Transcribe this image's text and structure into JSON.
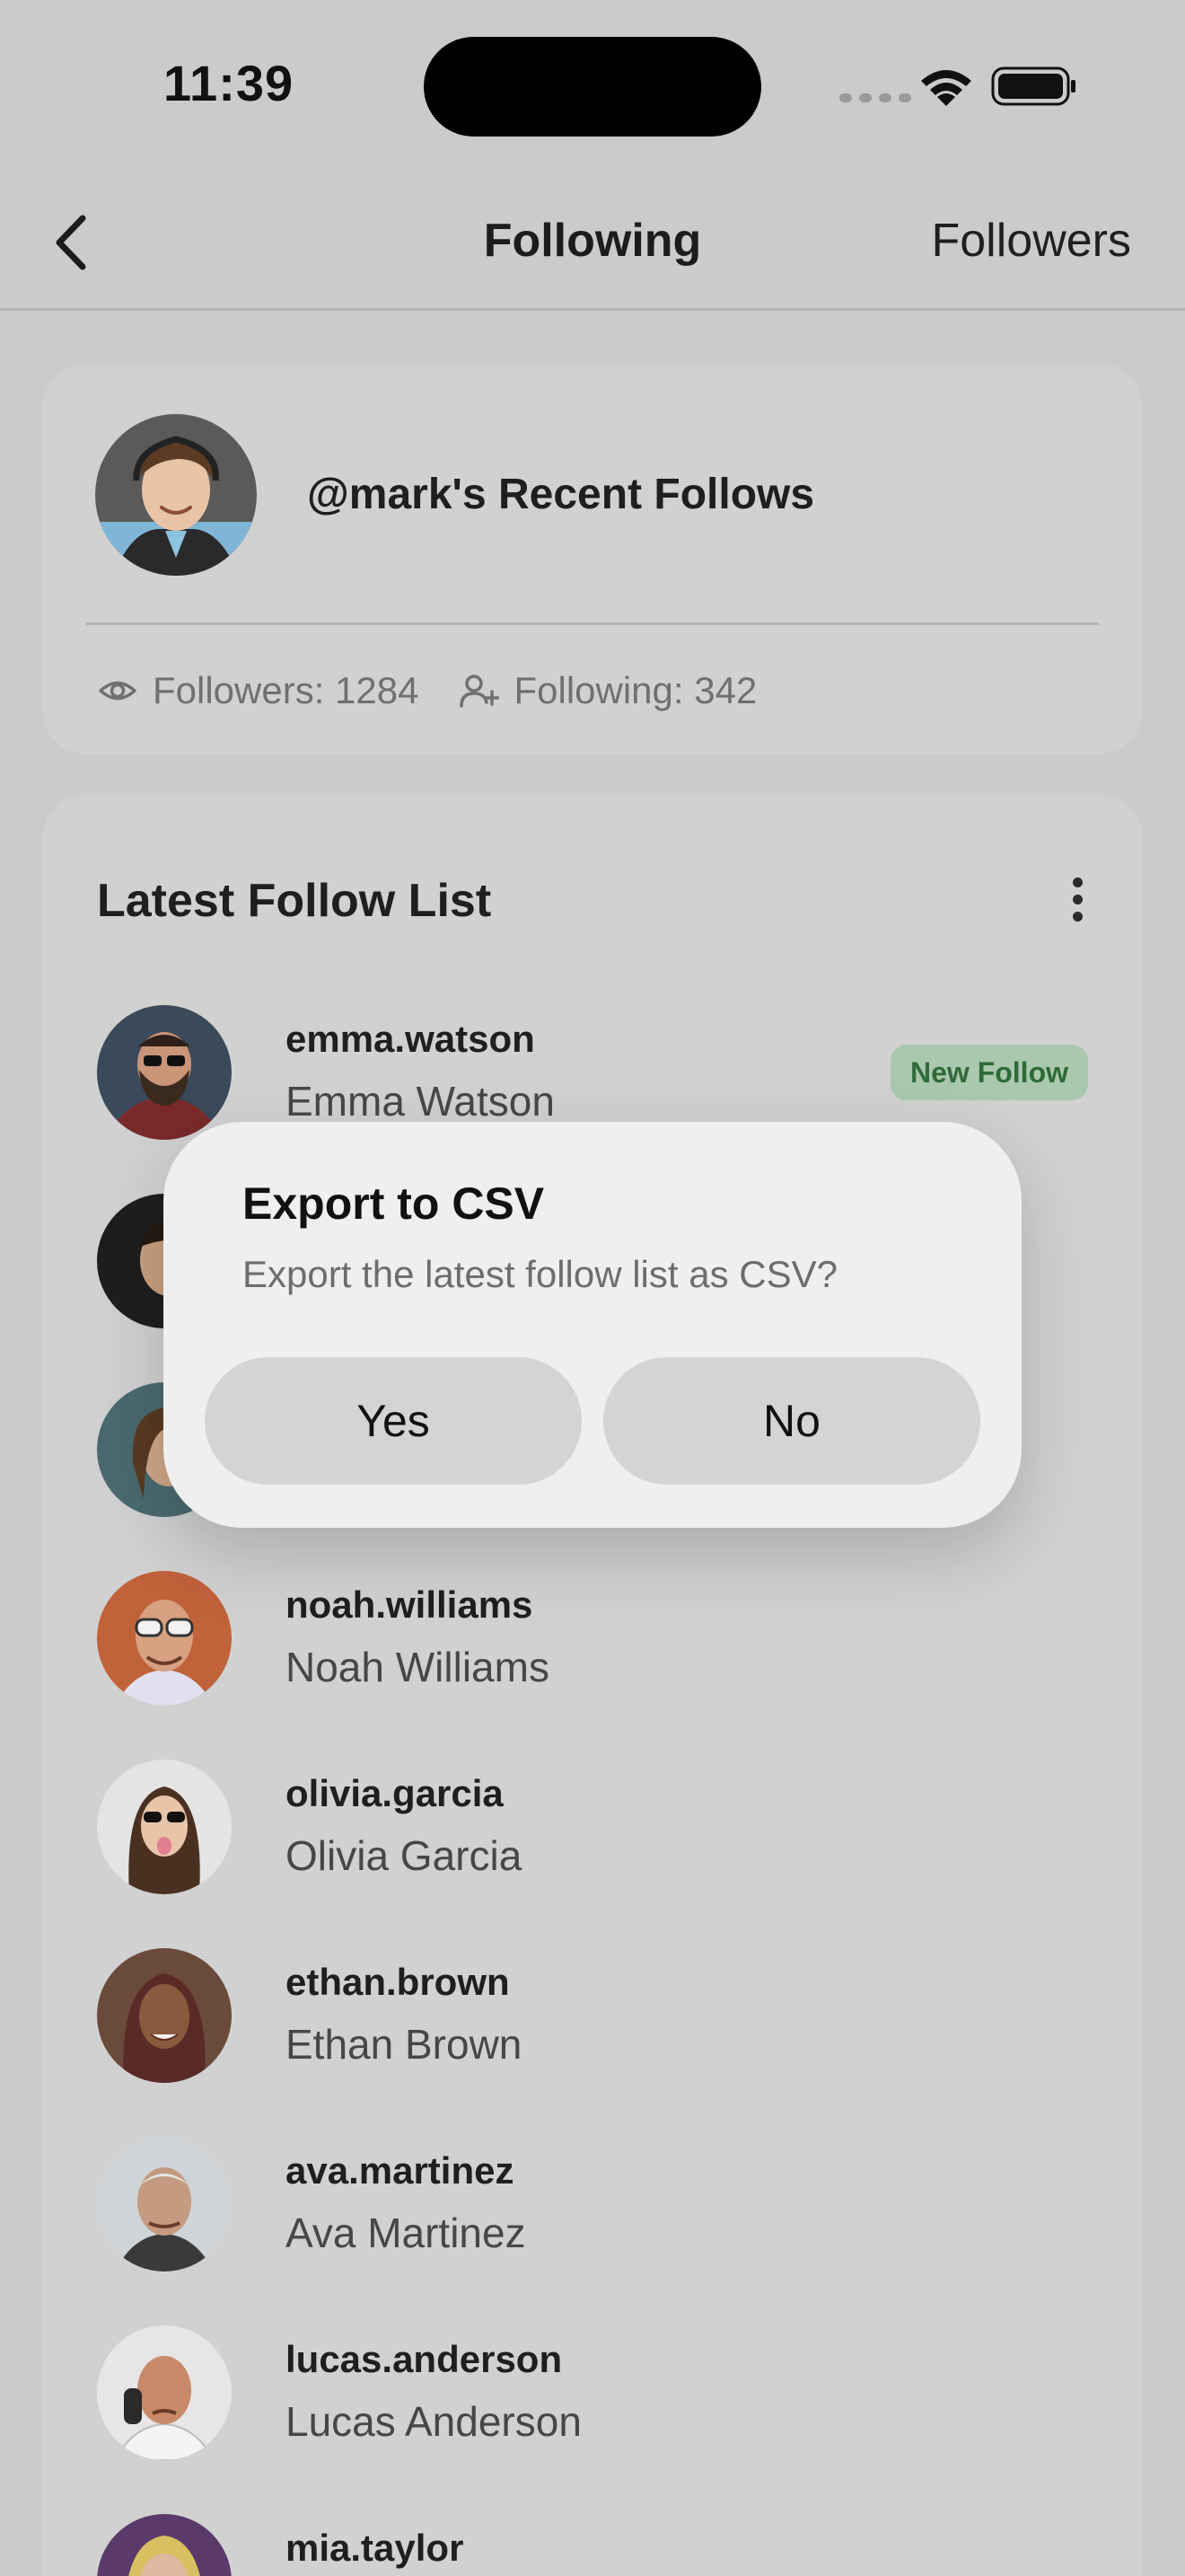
{
  "status_bar": {
    "time": "11:39"
  },
  "nav": {
    "title": "Following",
    "right_link": "Followers"
  },
  "profile": {
    "title": "@mark's Recent Follows",
    "followers": "Followers: 1284",
    "following": "Following: 342"
  },
  "list": {
    "title": "Latest Follow List",
    "items": [
      {
        "username": "emma.watson",
        "name": "Emma Watson",
        "badge": "New Follow",
        "avatar": "bearded-man-sunglasses"
      },
      {
        "username": "",
        "name": "",
        "badge": "",
        "avatar": "smiling-man"
      },
      {
        "username": "",
        "name": "",
        "badge": "",
        "avatar": "man-long-hair"
      },
      {
        "username": "noah.williams",
        "name": "Noah Williams",
        "badge": "",
        "avatar": "man-sunglasses"
      },
      {
        "username": "olivia.garcia",
        "name": "Olivia Garcia",
        "badge": "",
        "avatar": "woman-sunglasses"
      },
      {
        "username": "ethan.brown",
        "name": "Ethan Brown",
        "badge": "",
        "avatar": "woman-smiling"
      },
      {
        "username": "ava.martinez",
        "name": "Ava Martinez",
        "badge": "",
        "avatar": "older-man"
      },
      {
        "username": "lucas.anderson",
        "name": "Lucas Anderson",
        "badge": "",
        "avatar": "man-on-phone"
      },
      {
        "username": "mia.taylor",
        "name": "",
        "badge": "",
        "avatar": "woman-purple"
      }
    ]
  },
  "dialog": {
    "title": "Export to CSV",
    "message": "Export the latest follow list as CSV?",
    "yes": "Yes",
    "no": "No"
  },
  "colors": {
    "background": "#cbcbcb",
    "card": "#d1d1d1",
    "badge_bg": "#a9c8ad",
    "badge_text": "#2f6b38",
    "dialog_bg": "#efefef"
  }
}
